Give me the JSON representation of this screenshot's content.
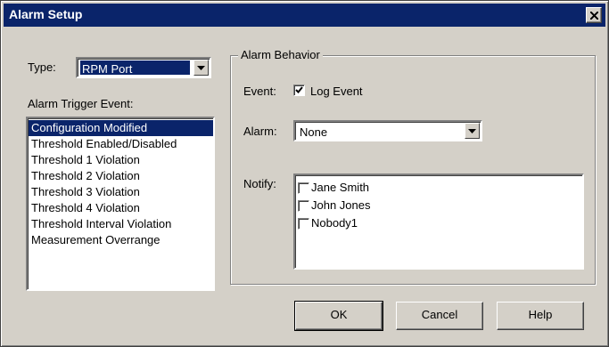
{
  "window": {
    "title": "Alarm Setup",
    "close_icon": "close-icon"
  },
  "type_field": {
    "label": "Type:",
    "value": "RPM Port"
  },
  "trigger": {
    "label": "Alarm Trigger Event:",
    "items": [
      {
        "label": "Configuration Modified",
        "selected": true
      },
      {
        "label": "Threshold Enabled/Disabled",
        "selected": false
      },
      {
        "label": "Threshold 1 Violation",
        "selected": false
      },
      {
        "label": "Threshold 2 Violation",
        "selected": false
      },
      {
        "label": "Threshold 3 Violation",
        "selected": false
      },
      {
        "label": "Threshold 4 Violation",
        "selected": false
      },
      {
        "label": "Threshold Interval Violation",
        "selected": false
      },
      {
        "label": "Measurement Overrange",
        "selected": false
      }
    ]
  },
  "behavior": {
    "group_title": "Alarm Behavior",
    "event_label": "Event:",
    "log_event_label": "Log Event",
    "log_event_checked": true,
    "alarm_label": "Alarm:",
    "alarm_value": "None",
    "notify_label": "Notify:",
    "notify_items": [
      {
        "label": "Jane Smith",
        "checked": false
      },
      {
        "label": "John Jones",
        "checked": false
      },
      {
        "label": "Nobody1",
        "checked": false
      }
    ]
  },
  "buttons": {
    "ok": "OK",
    "cancel": "Cancel",
    "help": "Help"
  },
  "colors": {
    "titlebar": "#0a246a",
    "face": "#d4d0c8",
    "selection": "#0a246a"
  }
}
